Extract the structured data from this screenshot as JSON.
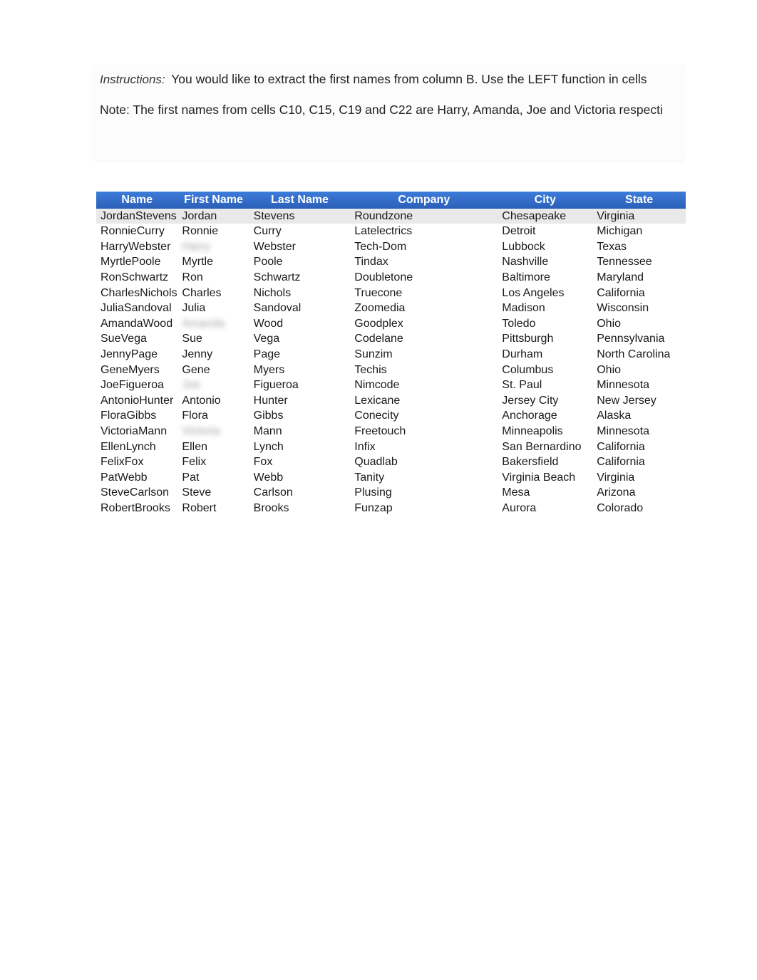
{
  "instructions": {
    "label": "Instructions:",
    "line1": "You would like to extract the first names from column B. Use the LEFT function in cells",
    "line2": "Note: The first names from cells C10, C15, C19 and C22 are Harry, Amanda, Joe and Victoria respecti"
  },
  "table": {
    "headers": {
      "name": "Name",
      "first_name": "First Name",
      "last_name": "Last Name",
      "company": "Company",
      "city": "City",
      "state": "State"
    },
    "rows": [
      {
        "name": "JordanStevens",
        "first_name": "Jordan",
        "last_name": "Stevens",
        "company": "Roundzone",
        "city": "Chesapeake",
        "state": "Virginia",
        "blurred": false
      },
      {
        "name": "RonnieCurry",
        "first_name": "Ronnie",
        "last_name": "Curry",
        "company": "Latelectrics",
        "city": "Detroit",
        "state": "Michigan",
        "blurred": false
      },
      {
        "name": "HarryWebster",
        "first_name": "Harry",
        "last_name": "Webster",
        "company": "Tech-Dom",
        "city": "Lubbock",
        "state": "Texas",
        "blurred": true
      },
      {
        "name": "MyrtlePoole",
        "first_name": "Myrtle",
        "last_name": "Poole",
        "company": "Tindax",
        "city": "Nashville",
        "state": "Tennessee",
        "blurred": false
      },
      {
        "name": "RonSchwartz",
        "first_name": "Ron",
        "last_name": "Schwartz",
        "company": "Doubletone",
        "city": "Baltimore",
        "state": "Maryland",
        "blurred": false
      },
      {
        "name": "CharlesNichols",
        "first_name": "Charles",
        "last_name": "Nichols",
        "company": "Truecone",
        "city": "Los Angeles",
        "state": "California",
        "blurred": false
      },
      {
        "name": "JuliaSandoval",
        "first_name": "Julia",
        "last_name": "Sandoval",
        "company": "Zoomedia",
        "city": "Madison",
        "state": "Wisconsin",
        "blurred": false
      },
      {
        "name": "AmandaWood",
        "first_name": "Amanda",
        "last_name": "Wood",
        "company": "Goodplex",
        "city": "Toledo",
        "state": "Ohio",
        "blurred": true
      },
      {
        "name": "SueVega",
        "first_name": "Sue",
        "last_name": "Vega",
        "company": "Codelane",
        "city": "Pittsburgh",
        "state": "Pennsylvania",
        "blurred": false
      },
      {
        "name": "JennyPage",
        "first_name": "Jenny",
        "last_name": "Page",
        "company": "Sunzim",
        "city": "Durham",
        "state": "North Carolina",
        "blurred": false
      },
      {
        "name": "GeneMyers",
        "first_name": "Gene",
        "last_name": "Myers",
        "company": "Techis",
        "city": "Columbus",
        "state": "Ohio",
        "blurred": false
      },
      {
        "name": "JoeFigueroa",
        "first_name": "Joe",
        "last_name": "Figueroa",
        "company": "Nimcode",
        "city": "St. Paul",
        "state": "Minnesota",
        "blurred": true
      },
      {
        "name": "AntonioHunter",
        "first_name": "Antonio",
        "last_name": "Hunter",
        "company": "Lexicane",
        "city": "Jersey City",
        "state": "New Jersey",
        "blurred": false
      },
      {
        "name": "FloraGibbs",
        "first_name": "Flora",
        "last_name": "Gibbs",
        "company": "Conecity",
        "city": "Anchorage",
        "state": "Alaska",
        "blurred": false
      },
      {
        "name": "VictoriaMann",
        "first_name": "Victoria",
        "last_name": "Mann",
        "company": "Freetouch",
        "city": "Minneapolis",
        "state": "Minnesota",
        "blurred": true
      },
      {
        "name": "EllenLynch",
        "first_name": "Ellen",
        "last_name": "Lynch",
        "company": "Infix",
        "city": "San Bernardino",
        "state": "California",
        "blurred": false
      },
      {
        "name": "FelixFox",
        "first_name": "Felix",
        "last_name": "Fox",
        "company": "Quadlab",
        "city": "Bakersfield",
        "state": "California",
        "blurred": false
      },
      {
        "name": "PatWebb",
        "first_name": "Pat",
        "last_name": "Webb",
        "company": "Tanity",
        "city": "Virginia Beach",
        "state": "Virginia",
        "blurred": false
      },
      {
        "name": "SteveCarlson",
        "first_name": "Steve",
        "last_name": "Carlson",
        "company": "Plusing",
        "city": "Mesa",
        "state": "Arizona",
        "blurred": false
      },
      {
        "name": "RobertBrooks",
        "first_name": "Robert",
        "last_name": "Brooks",
        "company": "Funzap",
        "city": "Aurora",
        "state": "Colorado",
        "blurred": false
      }
    ]
  }
}
